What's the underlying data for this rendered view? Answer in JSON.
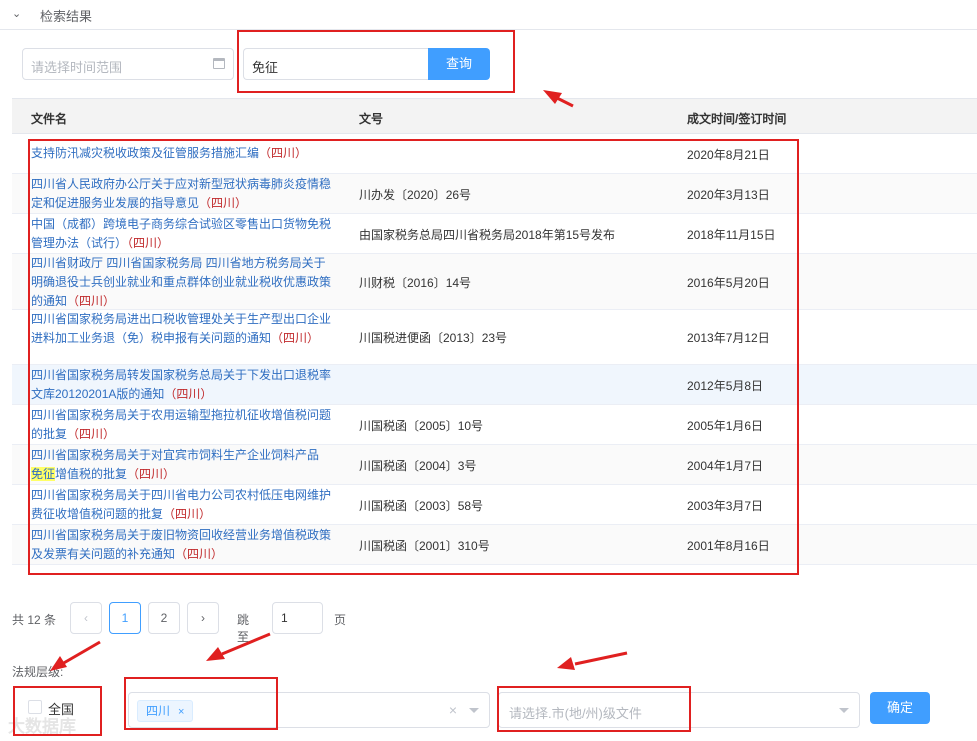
{
  "header": {
    "collapse_icon": "chevron-down-icon",
    "title": "检索结果"
  },
  "search": {
    "date_placeholder": "请选择时间范围",
    "keyword_value": "免征",
    "search_label": "查询"
  },
  "table": {
    "columns": [
      "文件名",
      "文号",
      "成文时间/签订时间"
    ],
    "rows": [
      {
        "name": "支持防汛减灾税收政策及征管服务措施汇编",
        "tag": "（四川）",
        "no": "",
        "date": "2020年8月21日"
      },
      {
        "name": "四川省人民政府办公厅关于应对新型冠状病毒肺炎疫情稳定和促进服务业发展的指导意见",
        "tag": "（四川）",
        "no": "川办发〔2020〕26号",
        "date": "2020年3月13日"
      },
      {
        "name": "中国（成都）跨境电子商务综合试验区零售出口货物免税管理办法（试行）",
        "tag": "（四川）",
        "no": "由国家税务总局四川省税务局2018年第15号发布",
        "date": "2018年11月15日"
      },
      {
        "name": "四川省财政厅 四川省国家税务局 四川省地方税务局关于明确退役士兵创业就业和重点群体创业就业税收优惠政策的通知",
        "tag": "（四川）",
        "no": "川财税〔2016〕14号",
        "date": "2016年5月20日"
      },
      {
        "name": "四川省国家税务局进出口税收管理处关于生产型出口企业进料加工业务退（免）税申报有关问题的通知",
        "tag": "（四川）",
        "no": "川国税进便函〔2013〕23号",
        "date": "2013年7月12日"
      },
      {
        "name": "四川省国家税务局转发国家税务总局关于下发出口退税率文库20120201A版的通知",
        "tag": "（四川）",
        "no": "",
        "date": "2012年5月8日"
      },
      {
        "name": "四川省国家税务局关于农用运输型拖拉机征收增值税问题的批复",
        "tag": "（四川）",
        "no": "川国税函〔2005〕10号",
        "date": "2005年1月6日"
      },
      {
        "name_pre": "四川省国家税务局关于对宜宾市饲料生产企业饲料产品",
        "name_mark": "免征",
        "name_post": "增值税的批复",
        "tag": "（四川）",
        "no": "川国税函〔2004〕3号",
        "date": "2004年1月7日"
      },
      {
        "name": "四川省国家税务局关于四川省电力公司农村低压电网维护费征收增值税问题的批复",
        "tag": "（四川）",
        "no": "川国税函〔2003〕58号",
        "date": "2003年3月7日"
      },
      {
        "name": "四川省国家税务局关于废旧物资回收经营业务增值税政策及发票有关问题的补充通知",
        "tag": "（四川）",
        "no": "川国税函〔2001〕310号",
        "date": "2001年8月16日"
      }
    ]
  },
  "pagination": {
    "total": "共 12 条",
    "prev_icon": "chevron-left-icon",
    "pages": [
      "1",
      "2"
    ],
    "next_icon": "chevron-right-icon",
    "jump_label": "跳至",
    "jump_value": "1",
    "page_suffix": "页"
  },
  "filters": {
    "level_label": "法规层级:",
    "national_label": "全国",
    "province_chip": "四川",
    "chip_close": "×",
    "clear_icon": "×",
    "city_placeholder": "请选择.市(地/州)级文件",
    "confirm_label": "确定"
  },
  "watermark": "大数据库",
  "colors": {
    "primary": "#409eff",
    "link": "#2f6ec1",
    "tag": "#c0292b",
    "annotation": "#e02020",
    "highlight": "#ffff66"
  }
}
